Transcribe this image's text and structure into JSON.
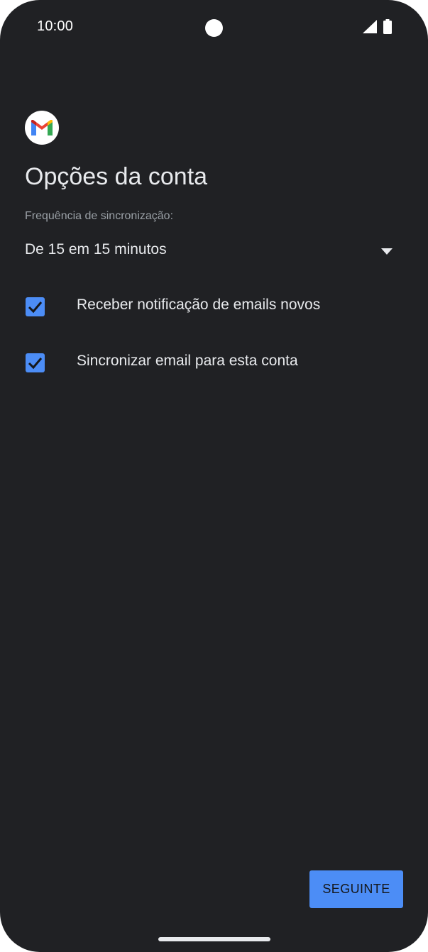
{
  "status_bar": {
    "time": "10:00",
    "signal_icon": "cellular-signal-icon",
    "battery_icon": "battery-icon"
  },
  "app": {
    "logo_icon": "gmail-icon"
  },
  "page": {
    "title": "Opções da conta"
  },
  "sync_frequency": {
    "label": "Frequência de sincronização:",
    "selected_value": "De 15 em 15 minutos",
    "arrow_icon": "dropdown-arrow-icon"
  },
  "options": [
    {
      "label": "Receber notificação de emails novos",
      "checked": true
    },
    {
      "label": "Sincronizar email para esta conta",
      "checked": true
    }
  ],
  "actions": {
    "next_label": "SEGUINTE"
  },
  "colors": {
    "background": "#202124",
    "accent": "#4c8df6",
    "text_primary": "#e8eaed",
    "text_secondary": "#9aa0a6"
  }
}
